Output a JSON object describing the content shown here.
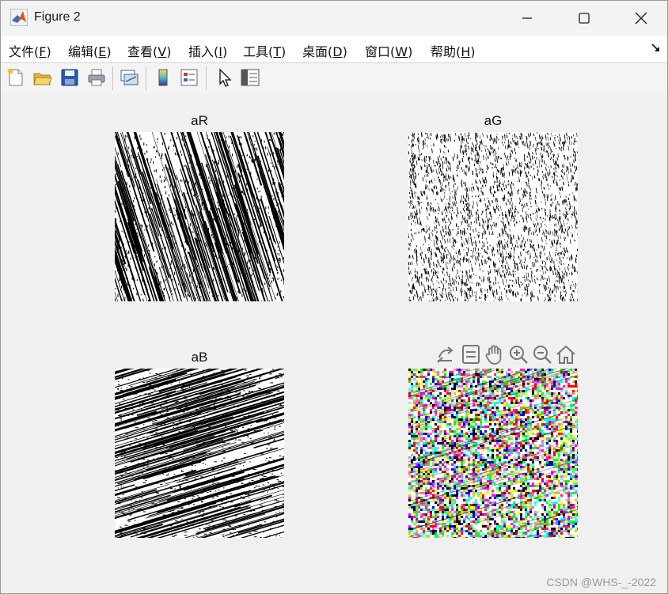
{
  "window": {
    "title": "Figure 2"
  },
  "menu": [
    {
      "label": "文件(",
      "key": "F",
      "end": ")"
    },
    {
      "label": "编辑(",
      "key": "E",
      "end": ")"
    },
    {
      "label": "查看(",
      "key": "V",
      "end": ")"
    },
    {
      "label": "插入(",
      "key": "I",
      "end": ")"
    },
    {
      "label": "工具(",
      "key": "T",
      "end": ")"
    },
    {
      "label": "桌面(",
      "key": "D",
      "end": ")"
    },
    {
      "label": "窗口(",
      "key": "W",
      "end": ")"
    },
    {
      "label": "帮助(",
      "key": "H",
      "end": ")"
    }
  ],
  "toolbar": {
    "icons": [
      "new-figure-icon",
      "open-file-icon",
      "save-icon",
      "print-icon",
      "link-plot-icon",
      "colorbar-icon",
      "legend-icon",
      "pointer-icon",
      "property-inspector-icon"
    ]
  },
  "axes": [
    {
      "title": "aR",
      "pattern": "steep-diagonal-noise",
      "color": "#000000"
    },
    {
      "title": "aG",
      "pattern": "vertical-noise",
      "color": "#000000"
    },
    {
      "title": "aB",
      "pattern": "shallow-diagonal-noise",
      "color": "#000000"
    },
    {
      "title": "",
      "pattern": "rgb-noise",
      "color": "#ff00ff"
    }
  ],
  "axes_toolbar": {
    "icons": [
      "export-icon",
      "data-tips-icon",
      "pan-hand-icon",
      "zoom-in-icon",
      "zoom-out-icon",
      "home-icon"
    ]
  },
  "watermark": "CSDN @WHS-_-2022"
}
